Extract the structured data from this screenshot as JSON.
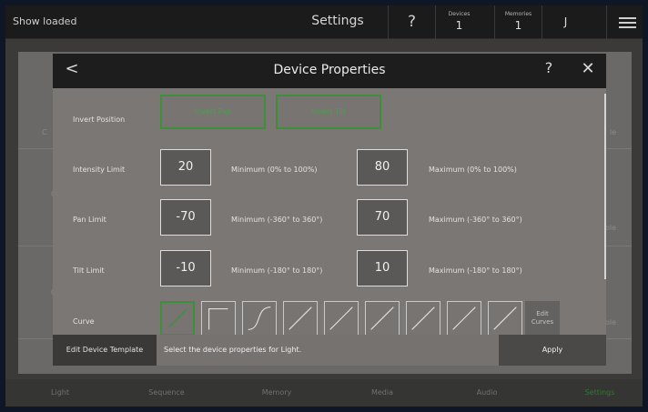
{
  "topbar": {
    "status": "Show loaded",
    "title": "Settings",
    "help": "?",
    "devices": {
      "label": "Devices",
      "value": "1"
    },
    "memories": {
      "label": "Memories",
      "value": "1"
    },
    "user": "J"
  },
  "background": {
    "fragments": [
      "C",
      "C",
      "C",
      "le",
      "ole",
      "ole"
    ]
  },
  "tabs": [
    {
      "label": "Light",
      "active": false
    },
    {
      "label": "Sequence",
      "active": false
    },
    {
      "label": "Memory",
      "active": false
    },
    {
      "label": "Media",
      "active": false
    },
    {
      "label": "Audio",
      "active": false
    },
    {
      "label": "Settings",
      "active": true
    }
  ],
  "dialog": {
    "back": "<",
    "title": "Device Properties",
    "help": "?",
    "close": "✕",
    "invert": {
      "label": "Invert Position",
      "pan": "Invert Pan",
      "tilt": "Invert Tilt"
    },
    "intensity": {
      "label": "Intensity Limit",
      "min": "20",
      "min_text": "Minimum (0% to 100%)",
      "max": "80",
      "max_text": "Maximum (0% to 100%)"
    },
    "pan": {
      "label": "Pan Limit",
      "min": "-70",
      "min_text": "Minimum (-360° to 360°)",
      "max": "70",
      "max_text": "Maximum (-360° to 360°)"
    },
    "tilt": {
      "label": "Tilt Limit",
      "min": "-10",
      "min_text": "Minimum (-180° to 180°)",
      "max": "10",
      "max_text": "Maximum (-180° to 180°)"
    },
    "curve": {
      "label": "Curve",
      "edit_line1": "Edit",
      "edit_line2": "Curves"
    },
    "footer": {
      "template": "Edit Device Template",
      "message": "Select the device properties for Light.",
      "apply": "Apply"
    }
  },
  "colors": {
    "accent_green": "#3e8f3a",
    "active_tab": "#2e7a2a"
  }
}
